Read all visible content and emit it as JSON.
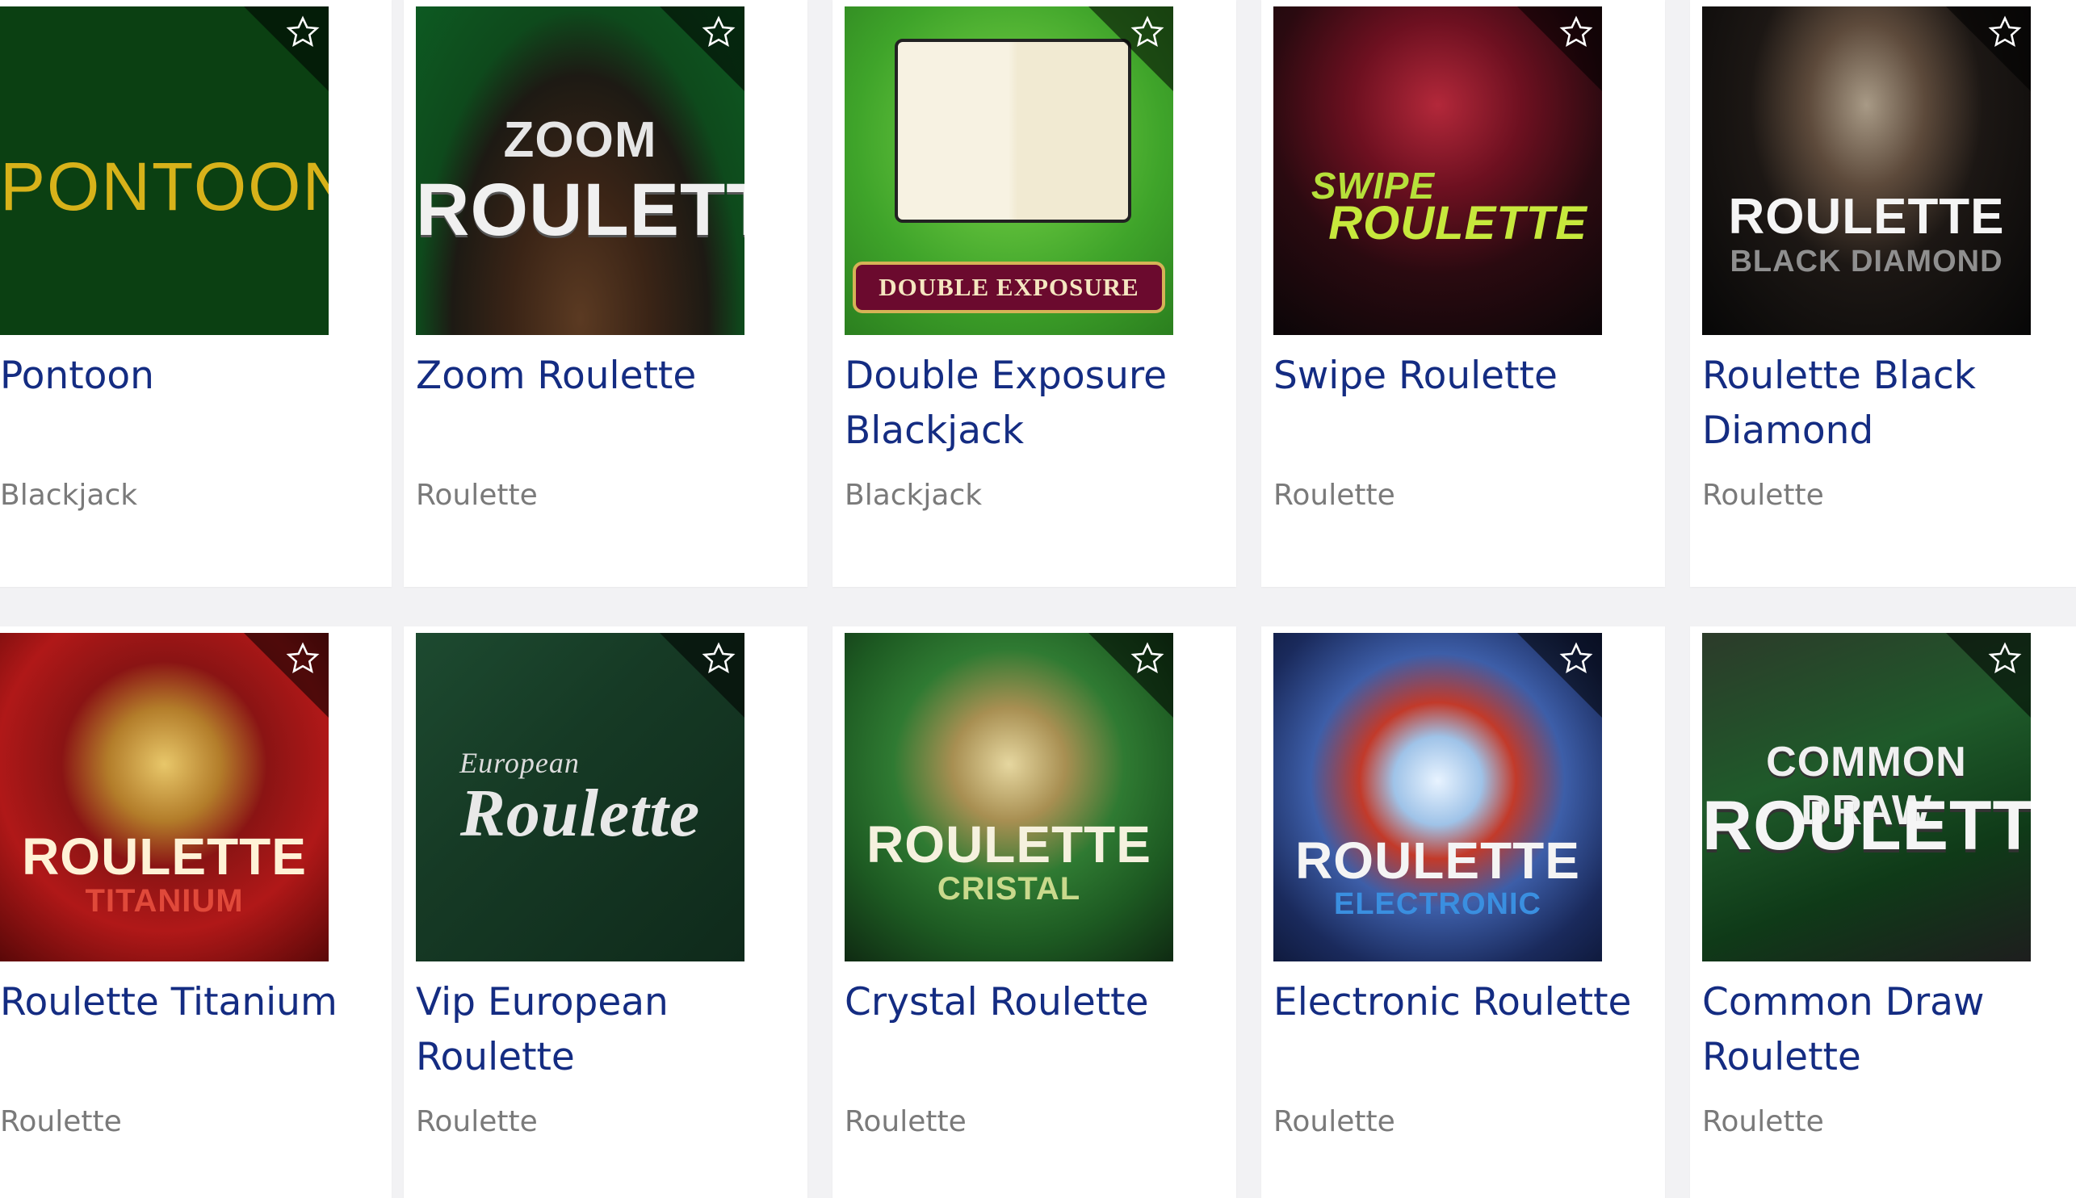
{
  "games": [
    {
      "title": "Pontoon",
      "category": "Blackjack",
      "art": [
        "PONTOON"
      ],
      "favorite_icon": "star-outline-icon"
    },
    {
      "title": "Zoom Roulette",
      "category": "Roulette",
      "art": [
        "ZOOM",
        "ROULETTE"
      ],
      "favorite_icon": "star-outline-icon"
    },
    {
      "title": "Double Exposure Blackjack",
      "category": "Blackjack",
      "art": [
        "DOUBLE EXPOSURE"
      ],
      "favorite_icon": "star-outline-icon"
    },
    {
      "title": "Swipe Roulette",
      "category": "Roulette",
      "art": [
        "SWIPE",
        "ROULETTE"
      ],
      "favorite_icon": "star-outline-icon"
    },
    {
      "title": "Roulette Black Diamond",
      "category": "Roulette",
      "art": [
        "ROULETTE",
        "BLACK DIAMOND"
      ],
      "favorite_icon": "star-outline-icon"
    },
    {
      "title": "Roulette Titanium",
      "category": "Roulette",
      "art": [
        "ROULETTE",
        "TITANIUM"
      ],
      "favorite_icon": "star-outline-icon"
    },
    {
      "title": "Vip European Roulette",
      "category": "Roulette",
      "art": [
        "European",
        "Roulette"
      ],
      "favorite_icon": "star-outline-icon"
    },
    {
      "title": "Crystal Roulette",
      "category": "Roulette",
      "art": [
        "ROULETTE",
        "CRISTAL"
      ],
      "favorite_icon": "star-outline-icon"
    },
    {
      "title": "Electronic Roulette",
      "category": "Roulette",
      "art": [
        "ROULETTE",
        "ELECTRONIC"
      ],
      "favorite_icon": "star-outline-icon"
    },
    {
      "title": "Common Draw Roulette",
      "category": "Roulette",
      "art": [
        "COMMON DRAW",
        "ROULETTE"
      ],
      "favorite_icon": "star-outline-icon"
    }
  ],
  "colors": {
    "title": "#142c82",
    "category": "#7a7a7a",
    "background": "#f2f2f4",
    "card": "#ffffff"
  }
}
